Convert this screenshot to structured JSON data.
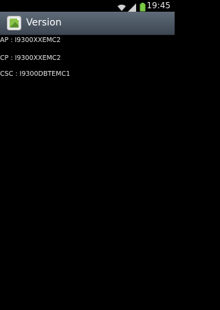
{
  "status_bar": {
    "time": "19:45"
  },
  "action_bar": {
    "title": "Version"
  },
  "version_info": [
    {
      "text": "AP : I9300XXEMC2"
    },
    {
      "text": "CP : I9300XXEMC2"
    },
    {
      "text": "CSC : I9300DBTEMC1"
    }
  ],
  "colors": {
    "action_bar_top": "#5f6b78",
    "action_bar_bottom": "#3e4753",
    "battery": "#7ac943"
  }
}
